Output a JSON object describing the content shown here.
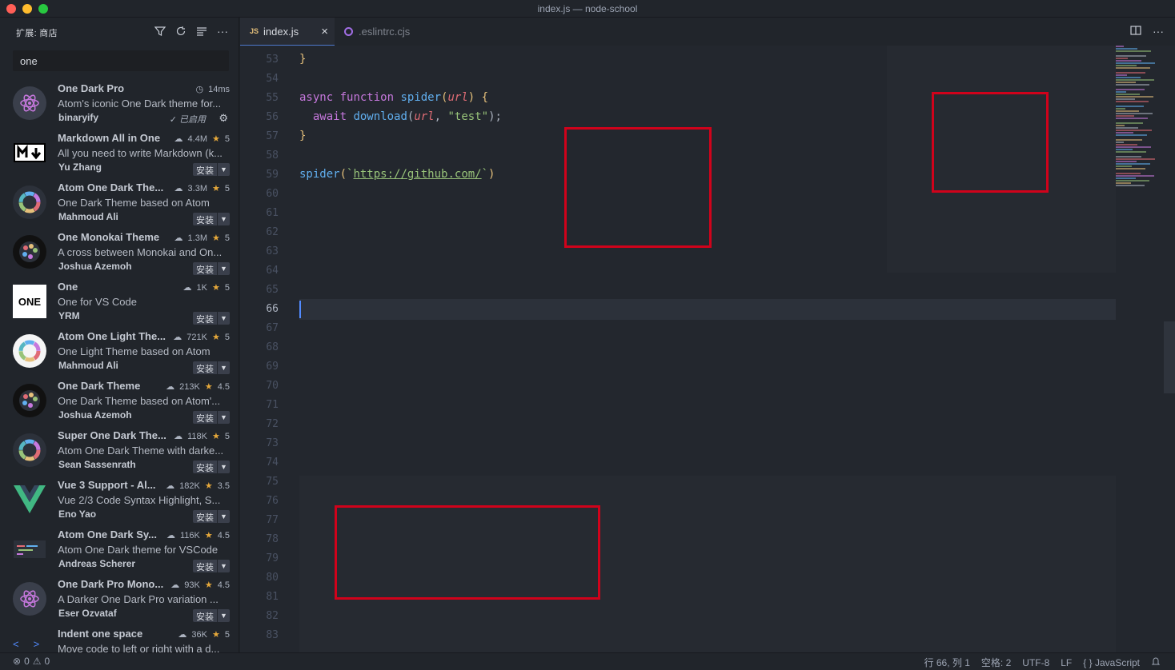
{
  "window": {
    "title": "index.js — node-school"
  },
  "sidebar": {
    "title": "扩展: 商店",
    "search_value": "one",
    "extensions": [
      {
        "name": "One Dark Pro",
        "stats": "14ms",
        "stats_icon": "history-icon",
        "description": "Atom's iconic One Dark theme for...",
        "author": "binaryify",
        "status": "已启用",
        "icon": "atom-icon",
        "icon_bg": "#3a3f4b"
      },
      {
        "name": "Markdown All in One",
        "downloads": "4.4M",
        "rating": "5",
        "description": "All you need to write Markdown (k...",
        "author": "Yu Zhang",
        "install": "安装",
        "icon": "markdown-icon",
        "icon_bg": "#ffffff"
      },
      {
        "name": "Atom One Dark The...",
        "downloads": "3.3M",
        "rating": "5",
        "description": "One Dark Theme based on Atom",
        "author": "Mahmoud Ali",
        "install": "安装",
        "icon": "color-ring-icon",
        "icon_bg": "#2c313a"
      },
      {
        "name": "One Monokai Theme",
        "downloads": "1.3M",
        "rating": "5",
        "description": "A cross between Monokai and On...",
        "author": "Joshua Azemoh",
        "install": "安装",
        "icon": "palette-icon",
        "icon_bg": "#111111"
      },
      {
        "name": "One",
        "downloads": "1K",
        "rating": "5",
        "description": "One for VS Code",
        "author": "YRM",
        "install": "安装",
        "icon": "one-logo-icon",
        "icon_bg": "#ffffff",
        "icon_text": "ONE"
      },
      {
        "name": "Atom One Light The...",
        "downloads": "721K",
        "rating": "5",
        "description": "One Light Theme based on Atom",
        "author": "Mahmoud Ali",
        "install": "安装",
        "icon": "color-ring-icon",
        "icon_bg": "#f5f5f5"
      },
      {
        "name": "One Dark Theme",
        "downloads": "213K",
        "rating": "4.5",
        "description": "One Dark Theme based on Atom'...",
        "author": "Joshua Azemoh",
        "install": "安装",
        "icon": "palette-icon",
        "icon_bg": "#111111"
      },
      {
        "name": "Super One Dark The...",
        "downloads": "118K",
        "rating": "5",
        "description": "Atom One Dark Theme with darke...",
        "author": "Sean Sassenrath",
        "install": "安装",
        "icon": "color-ring-icon",
        "icon_bg": "#2c313a"
      },
      {
        "name": "Vue 3 Support - Al...",
        "downloads": "182K",
        "rating": "3.5",
        "description": "Vue 2/3 Code Syntax Highlight, S...",
        "author": "Eno Yao",
        "install": "安装",
        "icon": "vue-icon",
        "icon_bg": "transparent"
      },
      {
        "name": "Atom One Dark Sy...",
        "downloads": "116K",
        "rating": "4.5",
        "description": "Atom One Dark theme for VSCode",
        "author": "Andreas Scherer",
        "install": "安装",
        "icon": "code-preview-icon",
        "icon_bg": "#2c313a"
      },
      {
        "name": "One Dark Pro Mono...",
        "downloads": "93K",
        "rating": "4.5",
        "description": "A Darker One Dark Pro variation ...",
        "author": "Eser Ozvataf",
        "install": "安装",
        "icon": "atom-icon",
        "icon_bg": "#3a3f4b"
      },
      {
        "name": "Indent one space",
        "downloads": "36K",
        "rating": "5",
        "description": "Move code to left or right with a d...",
        "author": "",
        "install": "",
        "icon": "",
        "icon_bg": "transparent"
      }
    ]
  },
  "tabs": [
    {
      "label": "index.js",
      "badge": "JS",
      "active": true
    },
    {
      "label": ".eslintrc.cjs",
      "active": false
    }
  ],
  "editor": {
    "line_numbers": [
      "53",
      "54",
      "55",
      "56",
      "57",
      "58",
      "59",
      "60",
      "61",
      "62",
      "63",
      "64",
      "65",
      "66",
      "67",
      "68",
      "69",
      "70",
      "71",
      "72",
      "73",
      "74",
      "75",
      "76",
      "77",
      "78",
      "79",
      "80",
      "81",
      "82",
      "83"
    ],
    "current_line": "66",
    "code": {
      "l53": "}",
      "l55_kw1": "async",
      "l55_kw2": "function",
      "l55_fn": "spider",
      "l55_param": "url",
      "l56_kw": "await",
      "l56_fn": "download",
      "l56_param": "url",
      "l56_str": "\"test\"",
      "l57": "}",
      "l59_fn": "spider",
      "l59_url": "https://github.com/"
    }
  },
  "statusbar": {
    "errors": "0",
    "warnings": "0",
    "position": "行 66, 列 1",
    "spaces": "空格: 2",
    "encoding": "UTF-8",
    "eol": "LF",
    "language": "JavaScript"
  },
  "colors": {
    "accent": "#528bff",
    "highlight_box": "#d0021b",
    "star": "#e5a83b"
  }
}
